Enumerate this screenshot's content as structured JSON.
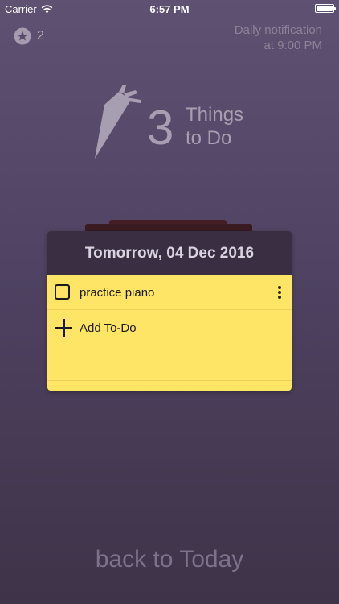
{
  "status_bar": {
    "carrier": "Carrier",
    "time": "6:57 PM"
  },
  "header": {
    "star_count": "2",
    "notification_line1": "Daily notification",
    "notification_line2": "at 9:00 PM"
  },
  "logo": {
    "number": "3",
    "line1": "Things",
    "line2": "to Do"
  },
  "card": {
    "title": "Tomorrow, 04 Dec 2016",
    "items": [
      {
        "label": "practice piano",
        "checked": false
      }
    ],
    "add_label": "Add To-Do"
  },
  "footer": {
    "back_label": "back to Today"
  },
  "colors": {
    "background_top": "#5f5171",
    "background_bottom": "#3e3348",
    "card_header": "#3a2e42",
    "card_body": "#ffe565"
  }
}
